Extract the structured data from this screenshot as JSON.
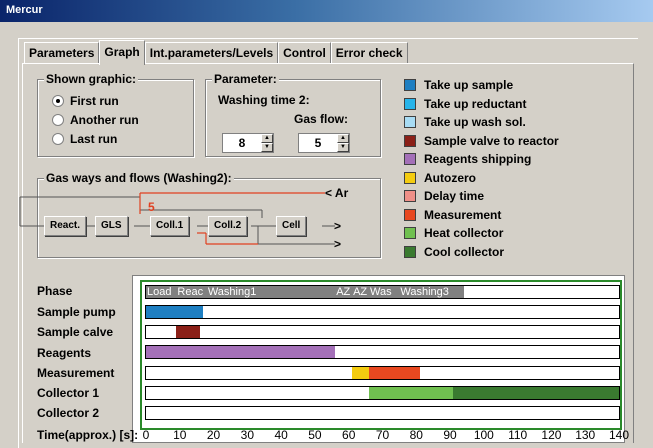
{
  "window": {
    "title": "Mercur"
  },
  "tabs": [
    "Parameters",
    "Graph",
    "Int.parameters/Levels",
    "Control",
    "Error check"
  ],
  "active_tab": "Graph",
  "shown_graphic": {
    "title": "Shown graphic:",
    "options": [
      "First run",
      "Another run",
      "Last run"
    ],
    "selected": "First run"
  },
  "parameter": {
    "title": "Parameter:",
    "subtitle": "Washing time 2:",
    "gas_flow_label": "Gas flow:",
    "washing_time_value": "8",
    "gas_flow_value": "5"
  },
  "legend": [
    {
      "label": "Take up sample",
      "color": "#1e7fc2"
    },
    {
      "label": "Take up reductant",
      "color": "#28b4ea"
    },
    {
      "label": "Take up wash sol.",
      "color": "#a8dcf4"
    },
    {
      "label": "Sample valve to reactor",
      "color": "#8b2018"
    },
    {
      "label": "Reagents shipping",
      "color": "#a470b8"
    },
    {
      "label": "Autozero",
      "color": "#f4cc10"
    },
    {
      "label": "Delay time",
      "color": "#f09088"
    },
    {
      "label": "Measurement",
      "color": "#e84820"
    },
    {
      "label": "Heat collector",
      "color": "#70c050"
    },
    {
      "label": "Cool collector",
      "color": "#3a7a30"
    }
  ],
  "gas_ways": {
    "title": "Gas ways and flows (Washing2):",
    "boxes": [
      "React.",
      "GLS",
      "Coll.1",
      "Coll.2",
      "Cell"
    ],
    "ar_label": "< Ar",
    "flow_value": "5",
    "arrow1": ">",
    "arrow2": ">"
  },
  "timeline": {
    "row_labels": [
      "Phase",
      "Sample pump",
      "Sample calve",
      "Reagents",
      "Measurement",
      "Collector 1",
      "Collector 2"
    ],
    "time_label": "Time(approx.) [s]:",
    "ticks": [
      "0",
      "10",
      "20",
      "30",
      "40",
      "50",
      "60",
      "70",
      "80",
      "90",
      "100",
      "110",
      "120",
      "130",
      "140"
    ],
    "phase_labels": [
      "Load",
      "Reac",
      "Washing1",
      "AZ",
      "AZ",
      "Was",
      "Washing3"
    ],
    "bar_colors": {
      "phase": "#808080",
      "sample_pump": "#1e7fc2",
      "sample_calve": "#8b2018",
      "reagents": "#a470b8",
      "autozero": "#f4cc10",
      "measurement": "#e84820",
      "heat": "#70c050",
      "cool": "#3a7a30",
      "chart_border": "#2a8a2a"
    },
    "time_max_s": 140,
    "bars": {
      "phase": [
        0,
        94
      ],
      "sample_pump": [
        0,
        17
      ],
      "sample_calve": [
        9,
        16
      ],
      "reagents": [
        0,
        56
      ],
      "autozero": [
        61,
        66
      ],
      "measurement": [
        66,
        81
      ],
      "heat": [
        66,
        91
      ],
      "cool": [
        91,
        140
      ]
    },
    "phase_label_times": [
      0,
      9,
      18,
      56,
      61,
      66,
      75
    ]
  }
}
